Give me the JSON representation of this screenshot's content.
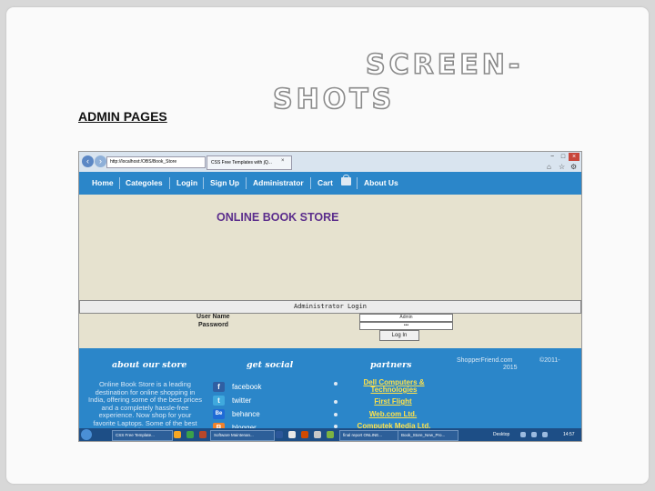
{
  "slide": {
    "admin_pages": "ADMIN PAGES",
    "title_line1": "SCREEN-",
    "title_line2": "SHOTS"
  },
  "browser": {
    "address": "http://localhost:/OBS/Book_Store",
    "tab_label": "CSS Free Templates with jQ...",
    "tab_close": "×",
    "back": "‹",
    "forward": "›",
    "window_controls": [
      "−",
      "□",
      "×"
    ],
    "tool_icons": [
      "home-icon",
      "star-icon",
      "gear-icon"
    ]
  },
  "site": {
    "nav": [
      "Home",
      "Categoles",
      "Login",
      "Sign Up",
      "Administrator",
      "Cart",
      "About Us"
    ],
    "store_title": "ONLINE BOOK STORE",
    "admin_login_bar": "Administrator Login",
    "login": {
      "user_label": "User Name",
      "password_label": "Password",
      "user_value": "Admin",
      "password_value": "•••",
      "button": "Log In"
    },
    "footer": {
      "about_heading": "about our store",
      "social_heading": "get social",
      "partners_heading": "partners",
      "copyright_line1": "ShopperFriend.com",
      "copyright_year1": "©2011-",
      "copyright_year2": "2015",
      "about_text": "Online Book Store is a leading destination for online shopping in India, offering some of the best prices and a completely hassle-free experience. Now shop for your favorite Laptops. Some of the best authors on",
      "social": [
        "facebook",
        "twitter",
        "behance",
        "blogger"
      ],
      "partners": [
        "Dell Computers & Technologies",
        "First Flight",
        "Web.com Ltd.",
        "Computek Media Ltd."
      ]
    }
  },
  "taskbar": {
    "items": [
      "CSS Free Template...",
      "Software Maintenan...",
      "final report ONLINE...",
      "Book_Store_New_Pro..."
    ],
    "desktop": "Desktop",
    "clock": "14:57"
  },
  "colors": {
    "nav_blue": "#2b86c9",
    "store_title": "#5b2d8c",
    "partner_link": "#ffe24a",
    "page_bg": "#e6e2cf",
    "taskbar": "#1d4e86"
  }
}
